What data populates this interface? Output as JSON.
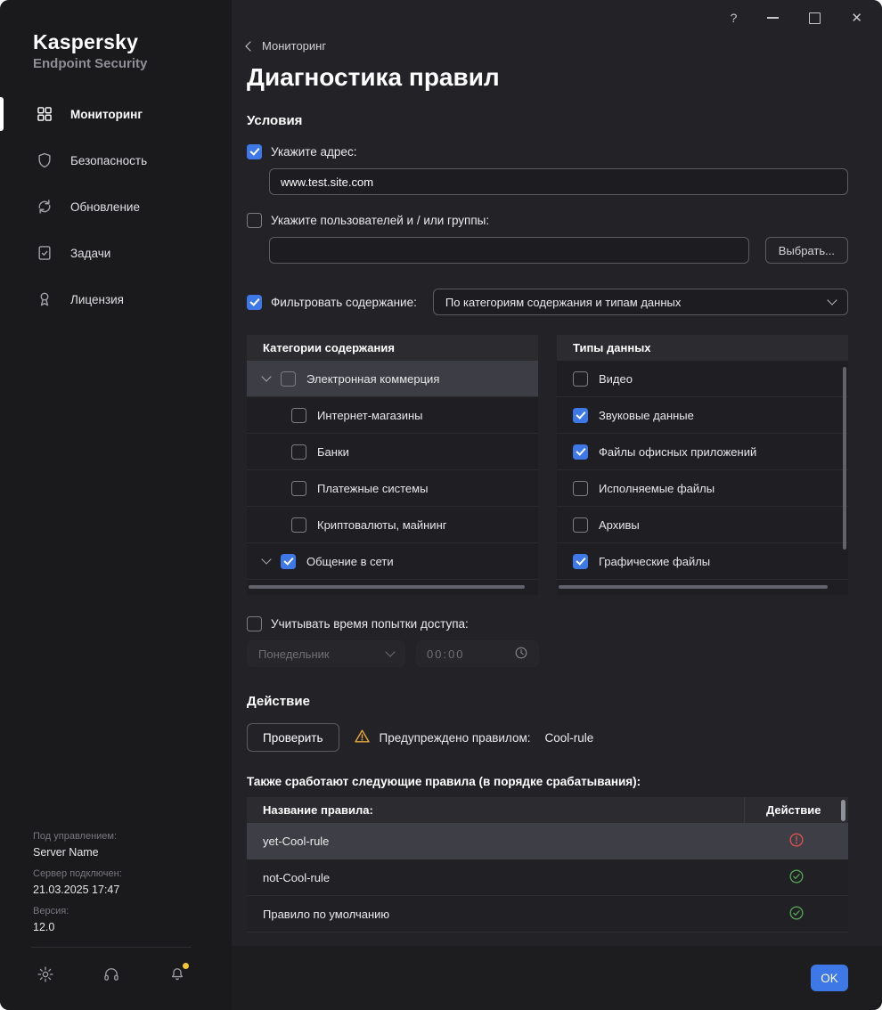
{
  "colors": {
    "accent": "#3e78e7",
    "warning": "#e2a63d",
    "error": "#d9534f",
    "success": "#54a254"
  },
  "icons": {
    "help": "?",
    "close": "✕"
  },
  "brand": {
    "name": "Kaspersky",
    "product": "Endpoint Security"
  },
  "sidebar": {
    "items": [
      {
        "label": "Мониторинг",
        "icon": "grid-icon",
        "active": true
      },
      {
        "label": "Безопасность",
        "icon": "shield-icon",
        "active": false
      },
      {
        "label": "Обновление",
        "icon": "refresh-icon",
        "active": false
      },
      {
        "label": "Задачи",
        "icon": "tasks-icon",
        "active": false
      },
      {
        "label": "Лицензия",
        "icon": "license-icon",
        "active": false
      }
    ],
    "server": {
      "managed_label": "Под управлением:",
      "name": "Server Name",
      "connected_label": "Сервер подключен:",
      "connected_time": "21.03.2025 17:47",
      "version_label": "Версия:",
      "version": "12.0"
    }
  },
  "main": {
    "breadcrumb": "Мониторинг",
    "title": "Диагностика правил",
    "conditions_heading": "Условия",
    "address": {
      "checked": true,
      "label": "Укажите адрес:",
      "value": "www.test.site.com"
    },
    "users": {
      "checked": false,
      "label": "Укажите пользователей и / или группы:",
      "value": "",
      "choose_button": "Выбрать..."
    },
    "filter": {
      "checked": true,
      "label": "Фильтровать содержание:",
      "selected": "По категориям содержания и типам данных"
    },
    "categories": {
      "header": "Категории содержания",
      "rows": [
        {
          "label": "Электронная коммерция",
          "checked": false,
          "expanded": true,
          "selected": true,
          "child": false
        },
        {
          "label": "Интернет-магазины",
          "checked": false,
          "child": true
        },
        {
          "label": "Банки",
          "checked": false,
          "child": true
        },
        {
          "label": "Платежные системы",
          "checked": false,
          "child": true
        },
        {
          "label": "Криптовалюты, майнинг",
          "checked": false,
          "child": true
        },
        {
          "label": "Общение в сети",
          "checked": true,
          "expanded": true,
          "child": false
        }
      ]
    },
    "types": {
      "header": "Типы данных",
      "rows": [
        {
          "label": "Видео",
          "checked": false
        },
        {
          "label": "Звуковые данные",
          "checked": true
        },
        {
          "label": "Файлы офисных приложений",
          "checked": true
        },
        {
          "label": "Исполняемые файлы",
          "checked": false
        },
        {
          "label": "Архивы",
          "checked": false
        },
        {
          "label": "Графические файлы",
          "checked": true
        }
      ]
    },
    "time": {
      "checked": false,
      "label": "Учитывать время попытки доступа:",
      "day": "Понедельник",
      "time": "00:00"
    },
    "action_heading": "Действие",
    "check": {
      "button": "Проверить",
      "result_label": "Предупреждено правилом:",
      "result_rule": "Cool-rule"
    },
    "rules_note": "Также сработают следующие правила (в порядке срабатывания):",
    "table": {
      "name_col": "Название правила:",
      "action_col": "Действие",
      "rows": [
        {
          "name": "yet-Cool-rule",
          "status": "warning",
          "selected": true
        },
        {
          "name": "not-Cool-rule",
          "status": "ok",
          "selected": false
        },
        {
          "name": "Правило по умолчанию",
          "status": "ok",
          "selected": false
        }
      ]
    },
    "ok": "OK"
  }
}
